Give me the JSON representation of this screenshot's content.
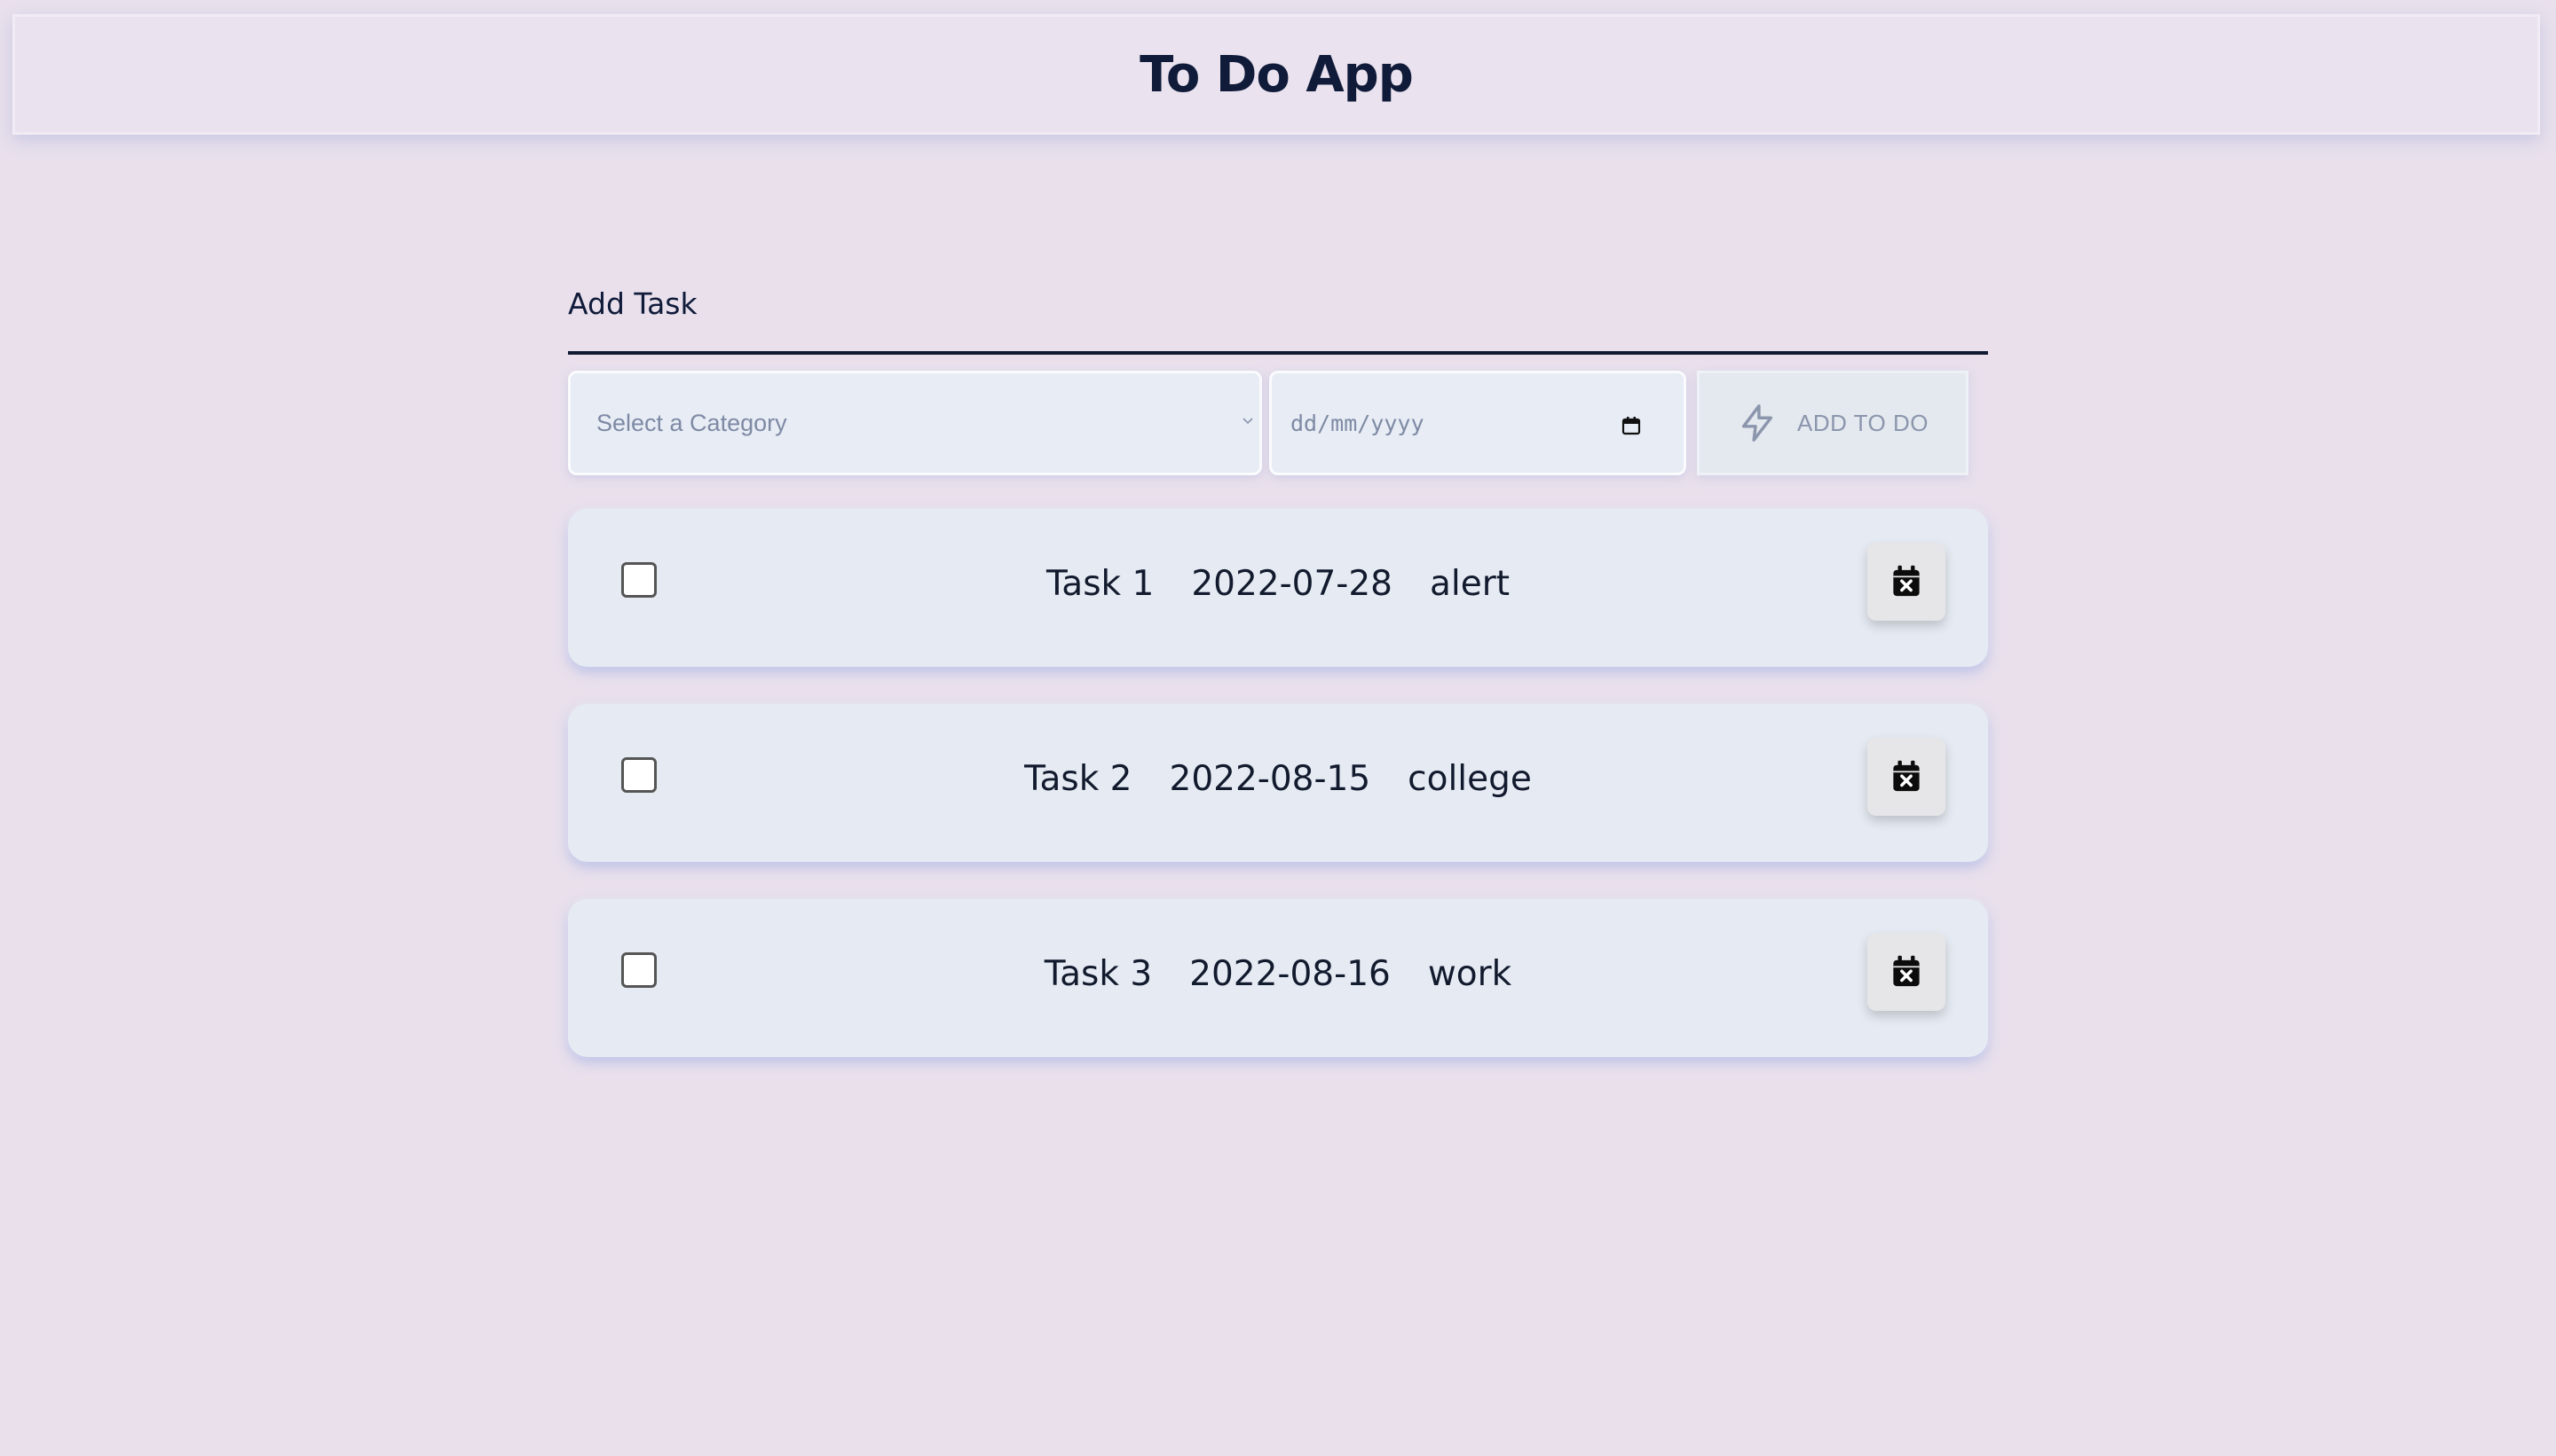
{
  "header": {
    "title": "To Do App"
  },
  "add_task": {
    "placeholder": "Add Task"
  },
  "controls": {
    "category_placeholder": "Select a Category",
    "date_placeholder": "dd/mm/yyyy",
    "add_button_label": "ADD TO DO"
  },
  "tasks": [
    {
      "name": "Task 1",
      "date": "2022-07-28",
      "category": "alert",
      "checked": false
    },
    {
      "name": "Task 2",
      "date": "2022-08-15",
      "category": "college",
      "checked": false
    },
    {
      "name": "Task 3",
      "date": "2022-08-16",
      "category": "work",
      "checked": false
    }
  ],
  "icons": {
    "delete": "calendar-x-icon",
    "add": "bolt-icon",
    "select": "chevron-down-icon",
    "date": "calendar-icon"
  },
  "colors": {
    "background": "#e9e0ec",
    "title": "#101b3a",
    "card": "#e6ebf3",
    "muted_text": "#7e8aa4"
  }
}
